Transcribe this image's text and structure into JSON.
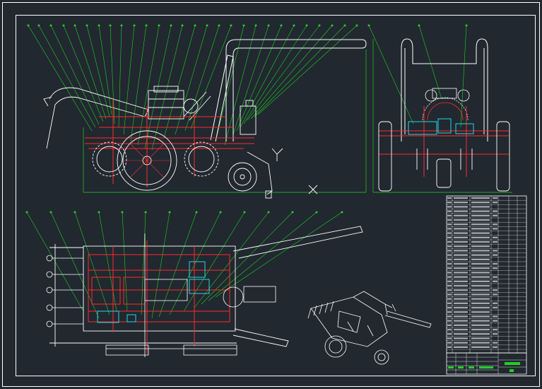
{
  "drawing": {
    "background": "#212830",
    "colors": {
      "frame": "#ffffff",
      "leader": "#22d022",
      "part_red": "#ff2a2a",
      "part_white": "#ffffff",
      "part_cyan": "#22d8e8",
      "part_green": "#22d022",
      "part_yellow": "#e6e62a"
    }
  },
  "views": {
    "side_view": {},
    "front_view": {},
    "top_view": {},
    "isometric_view": {}
  },
  "title_block": {
    "stamp_color": "#22d022"
  }
}
